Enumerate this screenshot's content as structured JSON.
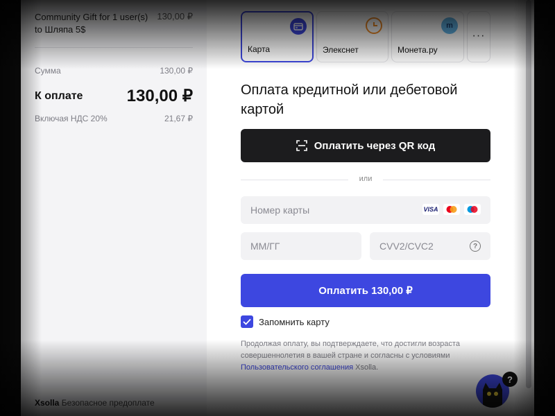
{
  "summary": {
    "item_name": "Community Gift for 1 user(s) to Шляпа 5$",
    "item_price": "130,00 ₽",
    "sum_label": "Сумма",
    "sum_value": "130,00 ₽",
    "total_label": "К оплате",
    "total_value": "130,00 ₽",
    "vat_label": "Включая НДС 20%",
    "vat_value": "21,67 ₽",
    "footer_brand": "Xsolla",
    "footer_text": "Безопасное предоплате"
  },
  "methods": [
    {
      "label": "Карта",
      "icon": "card-icon",
      "selected": true
    },
    {
      "label": "Элекснет",
      "icon": "eleksnet-icon",
      "selected": false
    },
    {
      "label": "Монета.ру",
      "icon": "moneta-icon",
      "selected": false
    }
  ],
  "methods_more": "···",
  "form": {
    "title": "Оплата кредитной или дебетовой картой",
    "qr_button": "Оплатить через QR код",
    "or_text": "или",
    "card_placeholder": "Номер карты",
    "expiry_placeholder": "ММ/ГГ",
    "cvv_placeholder": "CVV2/CVC2",
    "pay_button": "Оплатить 130,00 ₽",
    "remember_label": "Запомнить карту",
    "remember_checked": true,
    "legal_text": "Продолжая оплату, вы подтверждаете, что достигли возраста совершеннолетия в вашей стране и согласны с условиями",
    "legal_link": "Пользовательского соглашения",
    "legal_suffix": "Xsolla."
  },
  "card_logos": [
    "visa",
    "mastercard",
    "maestro"
  ],
  "visa_text": "VISA",
  "chat_badge": "?",
  "colors": {
    "accent": "#3d47e0",
    "dark_button": "#1c1c1e",
    "panel": "#f4f4f6"
  }
}
